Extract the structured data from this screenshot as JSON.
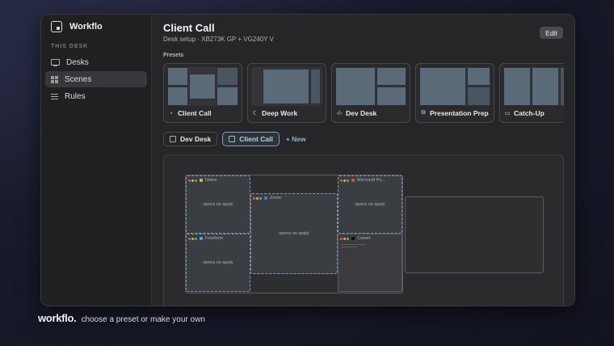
{
  "app": {
    "name": "Workflo",
    "logo_icon": "workflo-logo-icon"
  },
  "sidebar": {
    "section_label": "THIS DESK",
    "items": [
      {
        "label": "Desks",
        "icon": "monitor-icon",
        "active": false
      },
      {
        "label": "Scenes",
        "icon": "grid-icon",
        "active": true
      },
      {
        "label": "Rules",
        "icon": "list-icon",
        "active": false
      }
    ]
  },
  "header": {
    "title": "Client Call",
    "subtitle": "Desk setup · XB273K GP + VG240Y V",
    "edit_label": "Edit"
  },
  "presets": {
    "label": "Presets",
    "items": [
      {
        "label": "Client Call",
        "icon": "video-icon",
        "glyph": "▪"
      },
      {
        "label": "Deep Work",
        "icon": "moon-icon",
        "glyph": "☾"
      },
      {
        "label": "Dev Desk",
        "icon": "code-icon",
        "glyph": "‹/›"
      },
      {
        "label": "Presentation Prep",
        "icon": "slides-icon",
        "glyph": "⧉"
      },
      {
        "label": "Catch-Up",
        "icon": "inbox-icon",
        "glyph": "▭"
      }
    ]
  },
  "scenes": {
    "items": [
      {
        "label": "Dev Desk",
        "active": false
      },
      {
        "label": "Client Call",
        "active": true
      }
    ],
    "new_label": "+ New"
  },
  "layout": {
    "windows": [
      {
        "title": "Notes",
        "status": "opens on apply",
        "app_color": "#e0b040"
      },
      {
        "title": "Zoom",
        "status": "opens on apply",
        "app_color": "#3a7be0"
      },
      {
        "title": "Microsoft Po...",
        "status": "opens on apply",
        "app_color": "#d0503a"
      },
      {
        "title": "Freeform",
        "status": "opens on apply",
        "app_color": "#4aa0d8"
      },
      {
        "title": "Comet",
        "status": "",
        "app_color": "#222222"
      }
    ]
  },
  "footer": {
    "logo": "workflo.",
    "tagline": "choose a preset or make your own"
  }
}
